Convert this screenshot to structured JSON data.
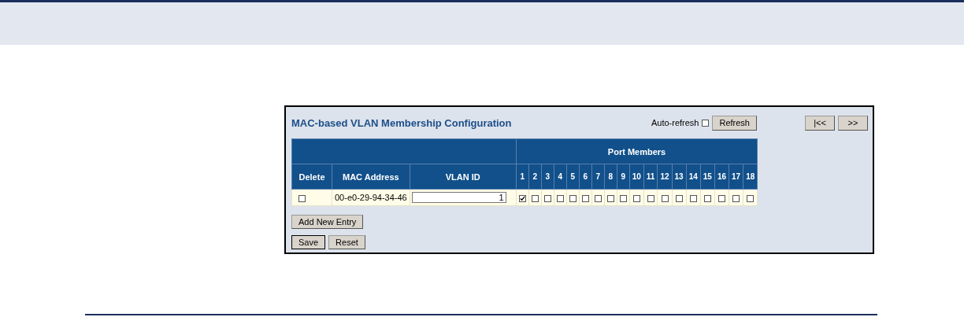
{
  "title": "MAC-based VLAN Membership Configuration",
  "auto_refresh": {
    "label": "Auto-refresh",
    "checked": false
  },
  "refresh_button": "Refresh",
  "nav_buttons": [
    "|<<",
    ">>"
  ],
  "table": {
    "group_header": "Port Members",
    "columns": [
      "Delete",
      "MAC Address",
      "VLAN ID"
    ],
    "port_numbers": [
      "1",
      "2",
      "3",
      "4",
      "5",
      "6",
      "7",
      "8",
      "9",
      "10",
      "11",
      "12",
      "13",
      "14",
      "15",
      "16",
      "17",
      "18"
    ],
    "rows": [
      {
        "delete": false,
        "mac": "00-e0-29-94-34-46",
        "vlan_id": "1",
        "ports": [
          true,
          false,
          false,
          false,
          false,
          false,
          false,
          false,
          false,
          false,
          false,
          false,
          false,
          false,
          false,
          false,
          false,
          false
        ]
      }
    ]
  },
  "add_button": "Add New Entry",
  "buttons": [
    "Save",
    "Reset"
  ]
}
